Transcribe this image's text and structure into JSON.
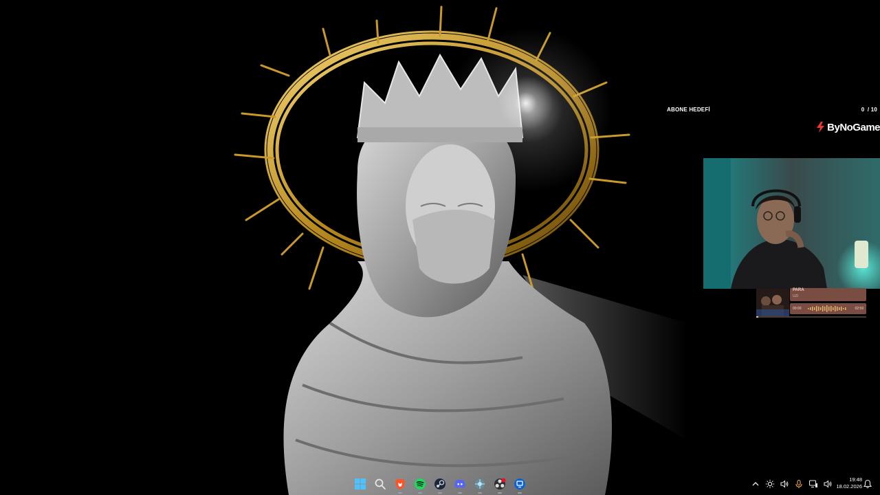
{
  "subgoal": {
    "label": "ABONE HEDEFİ",
    "current": "0",
    "target": "/ 10"
  },
  "brand": {
    "name": "ByNoGame",
    "logo_icon": "bynogame-logo-icon",
    "accent": "#e53935"
  },
  "music": {
    "title": "PARA",
    "artist": "UZI",
    "time_current": "00:00",
    "time_total": "02:59",
    "progress": 0.02,
    "accent": "#7a4d42"
  },
  "taskbar": {
    "icons": [
      {
        "name": "start-button",
        "icon": "windows-logo-icon"
      },
      {
        "name": "search-button",
        "icon": "search-icon"
      },
      {
        "name": "brave-browser-button",
        "icon": "brave-icon"
      },
      {
        "name": "spotify-button",
        "icon": "spotify-icon"
      },
      {
        "name": "steam-button",
        "icon": "steam-icon"
      },
      {
        "name": "discord-button",
        "icon": "discord-icon"
      },
      {
        "name": "network-app-button",
        "icon": "network-app-icon"
      },
      {
        "name": "obs-button",
        "icon": "obs-icon"
      },
      {
        "name": "remote-app-button",
        "icon": "remote-app-icon"
      }
    ]
  },
  "tray": {
    "icons": [
      "chevron-up-icon",
      "brightness-icon",
      "speaker-icon",
      "microphone-icon",
      "network-icon",
      "volume-icon"
    ],
    "time": "19:48",
    "date": "18.02.2026"
  }
}
